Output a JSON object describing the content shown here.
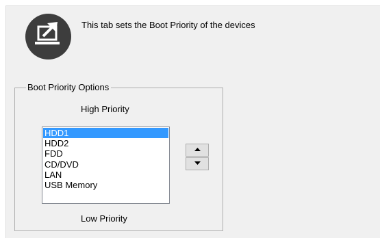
{
  "header": {
    "description": "This tab sets the Boot Priority of the devices",
    "icon": "laptop-arrow-icon"
  },
  "boot_priority": {
    "group_title": "Boot Priority Options",
    "high_label": "High Priority",
    "low_label": "Low Priority",
    "items": [
      {
        "label": "HDD1",
        "selected": true
      },
      {
        "label": "HDD2",
        "selected": false
      },
      {
        "label": "FDD",
        "selected": false
      },
      {
        "label": "CD/DVD",
        "selected": false
      },
      {
        "label": "LAN",
        "selected": false
      },
      {
        "label": "USB Memory",
        "selected": false
      }
    ],
    "move_up_icon": "triangle-up-icon",
    "move_down_icon": "triangle-down-icon"
  },
  "colors": {
    "selection": "#3399ff",
    "panel_background": "#f0f0f0",
    "icon_circle": "#3d3d3d"
  }
}
